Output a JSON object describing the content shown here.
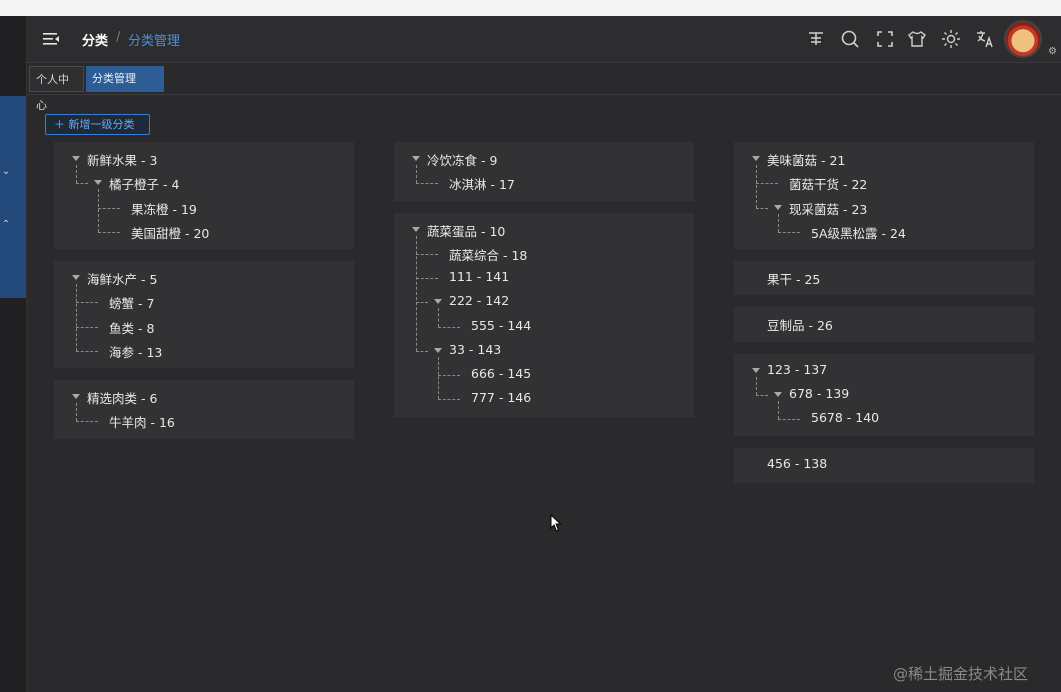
{
  "breadcrumb": {
    "root": "分类",
    "separator": "/",
    "current": "分类管理"
  },
  "tags": [
    "个人中心",
    "分类管理"
  ],
  "toolbar": {
    "add_label": "新增一级分类",
    "icons": [
      "size-icon",
      "search-icon",
      "fullscreen-icon",
      "theme-skin-icon",
      "sun-icon",
      "translate-icon"
    ]
  },
  "columns": [
    [
      {
        "label": "新鲜水果 - 3",
        "children": [
          {
            "label": "橘子橙子 - 4",
            "children": [
              {
                "label": "果冻橙 - 19"
              },
              {
                "label": "美国甜橙 - 20"
              }
            ]
          }
        ]
      },
      {
        "label": "海鲜水产 - 5",
        "children": [
          {
            "label": "螃蟹 - 7"
          },
          {
            "label": "鱼类 - 8"
          },
          {
            "label": "海参 - 13"
          }
        ]
      },
      {
        "label": "精选肉类 - 6",
        "children": [
          {
            "label": "牛羊肉 - 16"
          }
        ]
      }
    ],
    [
      {
        "label": "冷饮冻食 - 9",
        "children": [
          {
            "label": "冰淇淋 - 17"
          }
        ]
      },
      {
        "label": "蔬菜蛋品 - 10",
        "children": [
          {
            "label": "蔬菜综合 - 18"
          },
          {
            "label": "111 - 141"
          },
          {
            "label": "222 - 142",
            "children": [
              {
                "label": "555 - 144"
              }
            ]
          },
          {
            "label": "33 - 143",
            "children": [
              {
                "label": "666 - 145"
              },
              {
                "label": "777 - 146"
              }
            ]
          }
        ]
      }
    ],
    [
      {
        "label": "美味菌菇 - 21",
        "children": [
          {
            "label": "菌菇干货 - 22"
          },
          {
            "label": "现采菌菇 - 23",
            "children": [
              {
                "label": "5A级黑松露 - 24"
              }
            ]
          }
        ]
      },
      {
        "label": "果干 - 25"
      },
      {
        "label": "豆制品 - 26"
      },
      {
        "label": "123 - 137",
        "children": [
          {
            "label": "678 - 139",
            "children": [
              {
                "label": "5678 - 140"
              }
            ]
          }
        ]
      },
      {
        "label": "456 - 138"
      }
    ]
  ],
  "watermark": "@稀土掘金技术社区"
}
